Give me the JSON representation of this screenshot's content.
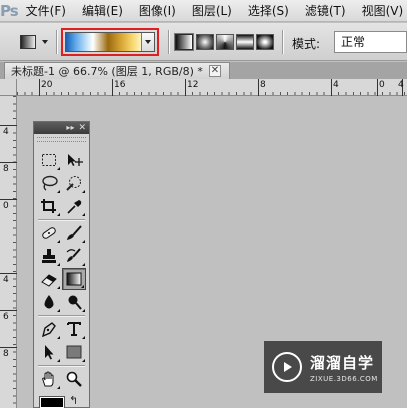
{
  "app": {
    "logo": "Ps"
  },
  "menu": [
    "文件(F)",
    "编辑(E)",
    "图像(I)",
    "图层(L)",
    "选择(S)",
    "滤镜(T)",
    "视图(V)"
  ],
  "options_bar": {
    "gradient_types": [
      "linear-gradient-icon",
      "radial-gradient-icon",
      "angle-gradient-icon",
      "reflected-gradient-icon",
      "diamond-gradient-icon"
    ],
    "mode_label": "模式:",
    "mode_value": "正常",
    "highlight_color": "#e02020"
  },
  "document": {
    "tab_title": "未标题-1 @ 66.7% (图层 1, RGB/8) *",
    "close": "✕"
  },
  "rulers": {
    "top_labels": [
      "20",
      "16",
      "12",
      "8",
      "4",
      "0",
      "4"
    ],
    "left_labels": [
      "4",
      "8",
      "0",
      "4",
      "8",
      "6"
    ]
  },
  "tools_panel": {
    "collapse": "▸▸",
    "close": "✕",
    "swap": "↰",
    "tools": [
      "rect-marquee-icon",
      "move-icon",
      "lasso-icon",
      "quick-select-icon",
      "crop-icon",
      "eyedropper-icon",
      "spot-heal-icon",
      "brush-icon",
      "clone-stamp-icon",
      "history-brush-icon",
      "eraser-icon",
      "gradient-icon",
      "blur-icon",
      "dodge-icon",
      "pen-icon",
      "type-icon",
      "path-select-icon",
      "rectangle-shape-icon",
      "hand-icon",
      "zoom-icon"
    ],
    "selected_tool": "gradient-icon"
  },
  "watermark": {
    "name": "溜溜自学",
    "url": "ZIXUE.3D66.COM"
  }
}
